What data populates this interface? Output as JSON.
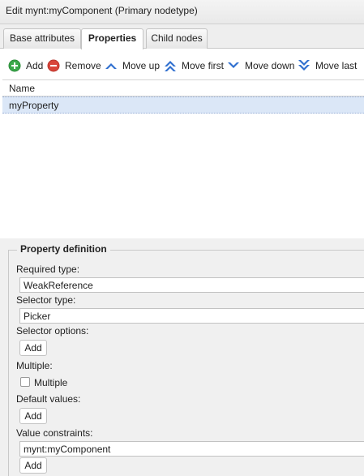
{
  "window": {
    "title": "Edit mynt:myComponent (Primary nodetype)"
  },
  "tabs": [
    {
      "label": "Base attributes"
    },
    {
      "label": "Properties"
    },
    {
      "label": "Child nodes"
    }
  ],
  "toolbar": {
    "add": {
      "label": "Add",
      "icon": "plus-circle-icon",
      "color": "#3aa84a"
    },
    "remove": {
      "label": "Remove",
      "icon": "minus-circle-icon",
      "color": "#d9453a"
    },
    "move_up": {
      "label": "Move up",
      "icon": "chevron-up-icon",
      "color": "#2f6fcf"
    },
    "move_first": {
      "label": "Move first",
      "icon": "double-chevron-up-icon",
      "color": "#2f6fcf"
    },
    "move_down": {
      "label": "Move down",
      "icon": "chevron-down-icon",
      "color": "#2f6fcf"
    },
    "move_last": {
      "label": "Move last",
      "icon": "double-chevron-down-icon",
      "color": "#2f6fcf"
    }
  },
  "grid": {
    "column_header": "Name",
    "rows": [
      {
        "name": "myProperty"
      }
    ]
  },
  "property_definition": {
    "legend": "Property definition",
    "required_type": {
      "label": "Required type:",
      "value": "WeakReference"
    },
    "selector_type": {
      "label": "Selector type:",
      "value": "Picker"
    },
    "selector_options": {
      "label": "Selector options:",
      "button": "Add"
    },
    "multiple": {
      "label": "Multiple:",
      "checkbox_label": "Multiple",
      "checked": false
    },
    "default_values": {
      "label": "Default values:",
      "button": "Add"
    },
    "value_constraints": {
      "label": "Value constraints:",
      "value": "mynt:myComponent",
      "button": "Add"
    }
  }
}
